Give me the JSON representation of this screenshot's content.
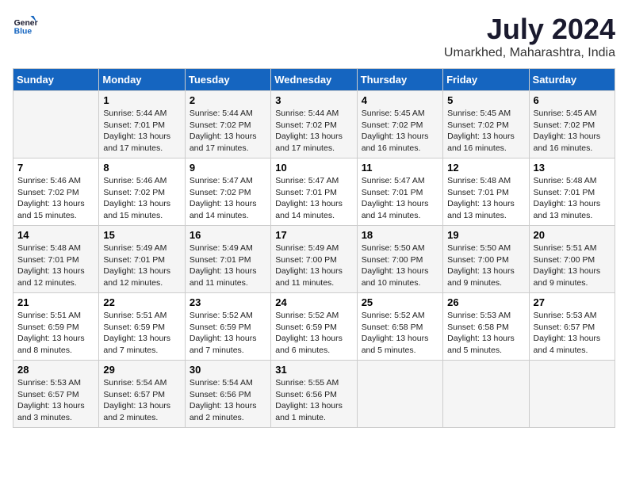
{
  "header": {
    "logo_line1": "General",
    "logo_line2": "Blue",
    "month": "July 2024",
    "location": "Umarkhed, Maharashtra, India"
  },
  "columns": [
    "Sunday",
    "Monday",
    "Tuesday",
    "Wednesday",
    "Thursday",
    "Friday",
    "Saturday"
  ],
  "weeks": [
    [
      {
        "day": "",
        "info": ""
      },
      {
        "day": "1",
        "info": "Sunrise: 5:44 AM\nSunset: 7:01 PM\nDaylight: 13 hours\nand 17 minutes."
      },
      {
        "day": "2",
        "info": "Sunrise: 5:44 AM\nSunset: 7:02 PM\nDaylight: 13 hours\nand 17 minutes."
      },
      {
        "day": "3",
        "info": "Sunrise: 5:44 AM\nSunset: 7:02 PM\nDaylight: 13 hours\nand 17 minutes."
      },
      {
        "day": "4",
        "info": "Sunrise: 5:45 AM\nSunset: 7:02 PM\nDaylight: 13 hours\nand 16 minutes."
      },
      {
        "day": "5",
        "info": "Sunrise: 5:45 AM\nSunset: 7:02 PM\nDaylight: 13 hours\nand 16 minutes."
      },
      {
        "day": "6",
        "info": "Sunrise: 5:45 AM\nSunset: 7:02 PM\nDaylight: 13 hours\nand 16 minutes."
      }
    ],
    [
      {
        "day": "7",
        "info": "Sunrise: 5:46 AM\nSunset: 7:02 PM\nDaylight: 13 hours\nand 15 minutes."
      },
      {
        "day": "8",
        "info": "Sunrise: 5:46 AM\nSunset: 7:02 PM\nDaylight: 13 hours\nand 15 minutes."
      },
      {
        "day": "9",
        "info": "Sunrise: 5:47 AM\nSunset: 7:02 PM\nDaylight: 13 hours\nand 14 minutes."
      },
      {
        "day": "10",
        "info": "Sunrise: 5:47 AM\nSunset: 7:01 PM\nDaylight: 13 hours\nand 14 minutes."
      },
      {
        "day": "11",
        "info": "Sunrise: 5:47 AM\nSunset: 7:01 PM\nDaylight: 13 hours\nand 14 minutes."
      },
      {
        "day": "12",
        "info": "Sunrise: 5:48 AM\nSunset: 7:01 PM\nDaylight: 13 hours\nand 13 minutes."
      },
      {
        "day": "13",
        "info": "Sunrise: 5:48 AM\nSunset: 7:01 PM\nDaylight: 13 hours\nand 13 minutes."
      }
    ],
    [
      {
        "day": "14",
        "info": "Sunrise: 5:48 AM\nSunset: 7:01 PM\nDaylight: 13 hours\nand 12 minutes."
      },
      {
        "day": "15",
        "info": "Sunrise: 5:49 AM\nSunset: 7:01 PM\nDaylight: 13 hours\nand 12 minutes."
      },
      {
        "day": "16",
        "info": "Sunrise: 5:49 AM\nSunset: 7:01 PM\nDaylight: 13 hours\nand 11 minutes."
      },
      {
        "day": "17",
        "info": "Sunrise: 5:49 AM\nSunset: 7:00 PM\nDaylight: 13 hours\nand 11 minutes."
      },
      {
        "day": "18",
        "info": "Sunrise: 5:50 AM\nSunset: 7:00 PM\nDaylight: 13 hours\nand 10 minutes."
      },
      {
        "day": "19",
        "info": "Sunrise: 5:50 AM\nSunset: 7:00 PM\nDaylight: 13 hours\nand 9 minutes."
      },
      {
        "day": "20",
        "info": "Sunrise: 5:51 AM\nSunset: 7:00 PM\nDaylight: 13 hours\nand 9 minutes."
      }
    ],
    [
      {
        "day": "21",
        "info": "Sunrise: 5:51 AM\nSunset: 6:59 PM\nDaylight: 13 hours\nand 8 minutes."
      },
      {
        "day": "22",
        "info": "Sunrise: 5:51 AM\nSunset: 6:59 PM\nDaylight: 13 hours\nand 7 minutes."
      },
      {
        "day": "23",
        "info": "Sunrise: 5:52 AM\nSunset: 6:59 PM\nDaylight: 13 hours\nand 7 minutes."
      },
      {
        "day": "24",
        "info": "Sunrise: 5:52 AM\nSunset: 6:59 PM\nDaylight: 13 hours\nand 6 minutes."
      },
      {
        "day": "25",
        "info": "Sunrise: 5:52 AM\nSunset: 6:58 PM\nDaylight: 13 hours\nand 5 minutes."
      },
      {
        "day": "26",
        "info": "Sunrise: 5:53 AM\nSunset: 6:58 PM\nDaylight: 13 hours\nand 5 minutes."
      },
      {
        "day": "27",
        "info": "Sunrise: 5:53 AM\nSunset: 6:57 PM\nDaylight: 13 hours\nand 4 minutes."
      }
    ],
    [
      {
        "day": "28",
        "info": "Sunrise: 5:53 AM\nSunset: 6:57 PM\nDaylight: 13 hours\nand 3 minutes."
      },
      {
        "day": "29",
        "info": "Sunrise: 5:54 AM\nSunset: 6:57 PM\nDaylight: 13 hours\nand 2 minutes."
      },
      {
        "day": "30",
        "info": "Sunrise: 5:54 AM\nSunset: 6:56 PM\nDaylight: 13 hours\nand 2 minutes."
      },
      {
        "day": "31",
        "info": "Sunrise: 5:55 AM\nSunset: 6:56 PM\nDaylight: 13 hours\nand 1 minute."
      },
      {
        "day": "",
        "info": ""
      },
      {
        "day": "",
        "info": ""
      },
      {
        "day": "",
        "info": ""
      }
    ]
  ]
}
